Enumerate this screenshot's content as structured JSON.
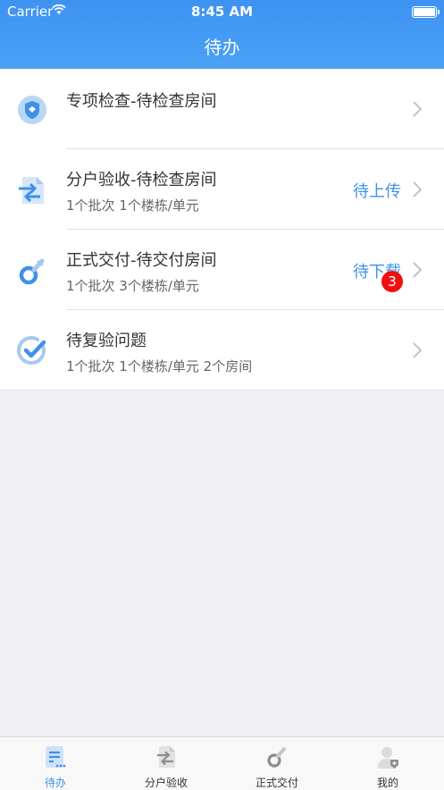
{
  "status_bar": {
    "carrier": "Carrier",
    "time": "8:45 AM"
  },
  "nav": {
    "title": "待办"
  },
  "rows": [
    {
      "title": "专项检查-待检查房间",
      "subtitle": "",
      "action": "",
      "icon": "shield-icon"
    },
    {
      "title": "分户验收-待检查房间",
      "subtitle": "1个批次  1个楼栋/单元",
      "action": "待上传",
      "icon": "document-transfer-icon"
    },
    {
      "title": "正式交付-待交付房间",
      "subtitle": "1个批次  3个楼栋/单元",
      "action": "待下载",
      "icon": "key-icon"
    },
    {
      "title": "待复验问题",
      "subtitle": "1个批次 1个楼栋/单元 2个房间",
      "badge": "3",
      "icon": "check-circle-icon"
    }
  ],
  "tabs": [
    {
      "label": "待办",
      "icon": "todo-list-icon",
      "active": true
    },
    {
      "label": "分户验收",
      "icon": "document-transfer-icon"
    },
    {
      "label": "正式交付",
      "icon": "key-icon"
    },
    {
      "label": "我的",
      "icon": "user-icon"
    }
  ],
  "colors": {
    "accent": "#3e91e8",
    "navbar": "#4099f3",
    "badge": "#ef1111",
    "background": "#efeff4"
  }
}
